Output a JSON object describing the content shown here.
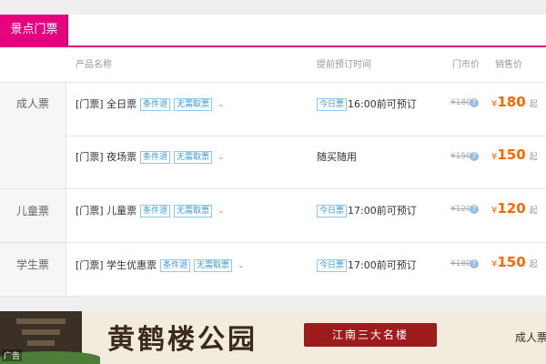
{
  "tab": {
    "label": "景点门票"
  },
  "columns": {
    "product": "产品名称",
    "advance": "提前预订时间",
    "market": "门市价",
    "sale": "销售价"
  },
  "categories": [
    {
      "label": "成人票"
    },
    {
      "label": "儿童票"
    },
    {
      "label": "学生票"
    }
  ],
  "rows": [
    {
      "name": "[门票] 全日票",
      "tags": [
        "条件退",
        "无需取票"
      ],
      "today_tag": "今日票",
      "advance": "16:00前可预订",
      "market_price": "¥180",
      "currency": "¥",
      "price": "180",
      "price_suffix": "起"
    },
    {
      "name": "[门票] 夜场票",
      "tags": [
        "条件退",
        "无需取票"
      ],
      "today_tag": "",
      "advance": "随买随用",
      "market_price": "¥150",
      "currency": "¥",
      "price": "150",
      "price_suffix": "起"
    },
    {
      "name": "[门票] 儿童票",
      "tags": [
        "条件退",
        "无需取票"
      ],
      "today_tag": "今日票",
      "advance": "17:00前可预订",
      "market_price": "¥120",
      "currency": "¥",
      "price": "120",
      "price_suffix": "起"
    },
    {
      "name": "[门票] 学生优惠票",
      "tags": [
        "条件退",
        "无需取票"
      ],
      "today_tag": "今日票",
      "advance": "17:00前可预订",
      "market_price": "¥180",
      "currency": "¥",
      "price": "150",
      "price_suffix": "起"
    }
  ],
  "banner": {
    "title": "黄鹤楼公园",
    "ribbon": "江南三大名楼",
    "right_text": "成人票",
    "ad_label": "广告"
  },
  "icons": {
    "chevron": "chevron-down-icon",
    "help": "question-mark-icon"
  },
  "colors": {
    "accent": "#e6007e",
    "price": "#ff6600",
    "tag": "#3a9ad9"
  }
}
